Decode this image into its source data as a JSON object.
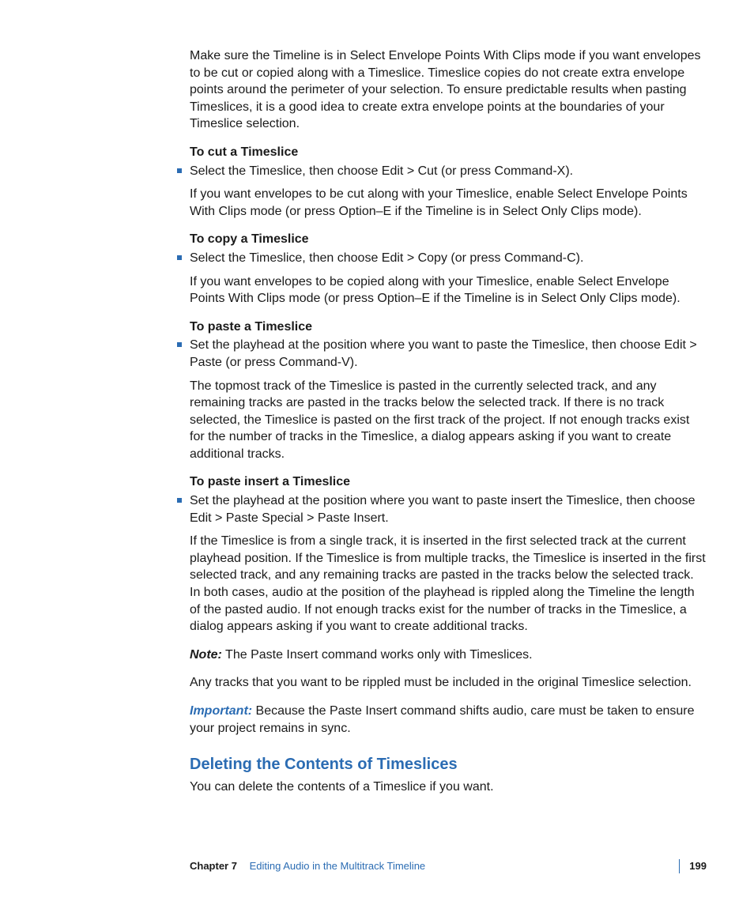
{
  "intro": "Make sure the Timeline is in Select Envelope Points With Clips mode if you want envelopes to be cut or copied along with a Timeslice. Timeslice copies do not create extra envelope points around the perimeter of your selection. To ensure predictable results when pasting Timeslices, it is a good idea to create extra envelope points at the boundaries of your Timeslice selection.",
  "s1": {
    "head": "To cut a Timeslice",
    "bullet": "Select the Timeslice, then choose Edit > Cut (or press Command-X).",
    "body": "If you want envelopes to be cut along with your Timeslice, enable Select Envelope Points With Clips mode (or press Option–E if the Timeline is in Select Only Clips mode)."
  },
  "s2": {
    "head": "To copy a Timeslice",
    "bullet": "Select the Timeslice, then choose Edit > Copy (or press Command-C).",
    "body": "If you want envelopes to be copied along with your Timeslice, enable Select Envelope Points With Clips mode (or press Option–E if the Timeline is in Select Only Clips mode)."
  },
  "s3": {
    "head": "To paste a Timeslice",
    "bullet": "Set the playhead at the position where you want to paste the Timeslice, then choose Edit > Paste (or press Command-V).",
    "body": "The topmost track of the Timeslice is pasted in the currently selected track, and any remaining tracks are pasted in the tracks below the selected track. If there is no track selected, the Timeslice is pasted on the first track of the project. If not enough tracks exist for the number of tracks in the Timeslice, a dialog appears asking if you want to create additional tracks."
  },
  "s4": {
    "head": "To paste insert a Timeslice",
    "bullet": "Set the playhead at the position where you want to paste insert the Timeslice, then choose Edit > Paste Special > Paste Insert.",
    "body": "If the Timeslice is from a single track, it is inserted in the first selected track at the current playhead position. If the Timeslice is from multiple tracks, the Timeslice is inserted in the first selected track, and any remaining tracks are pasted in the tracks below the selected track. In both cases, audio at the position of the playhead is rippled along the Timeline the length of the pasted audio. If not enough tracks exist for the number of tracks in the Timeslice, a dialog appears asking if you want to create additional tracks.",
    "note_label": "Note:",
    "note_text": "  The Paste Insert command works only with Timeslices.",
    "extra": "Any tracks that you want to be rippled must be included in the original Timeslice selection.",
    "important_label": "Important:",
    "important_text": "  Because the Paste Insert command shifts audio, care must be taken to ensure your project remains in sync."
  },
  "deleting": {
    "heading": "Deleting the Contents of Timeslices",
    "body": "You can delete the contents of a Timeslice if you want."
  },
  "footer": {
    "chapter": "Chapter 7",
    "title": "Editing Audio in the Multitrack Timeline",
    "page": "199"
  }
}
